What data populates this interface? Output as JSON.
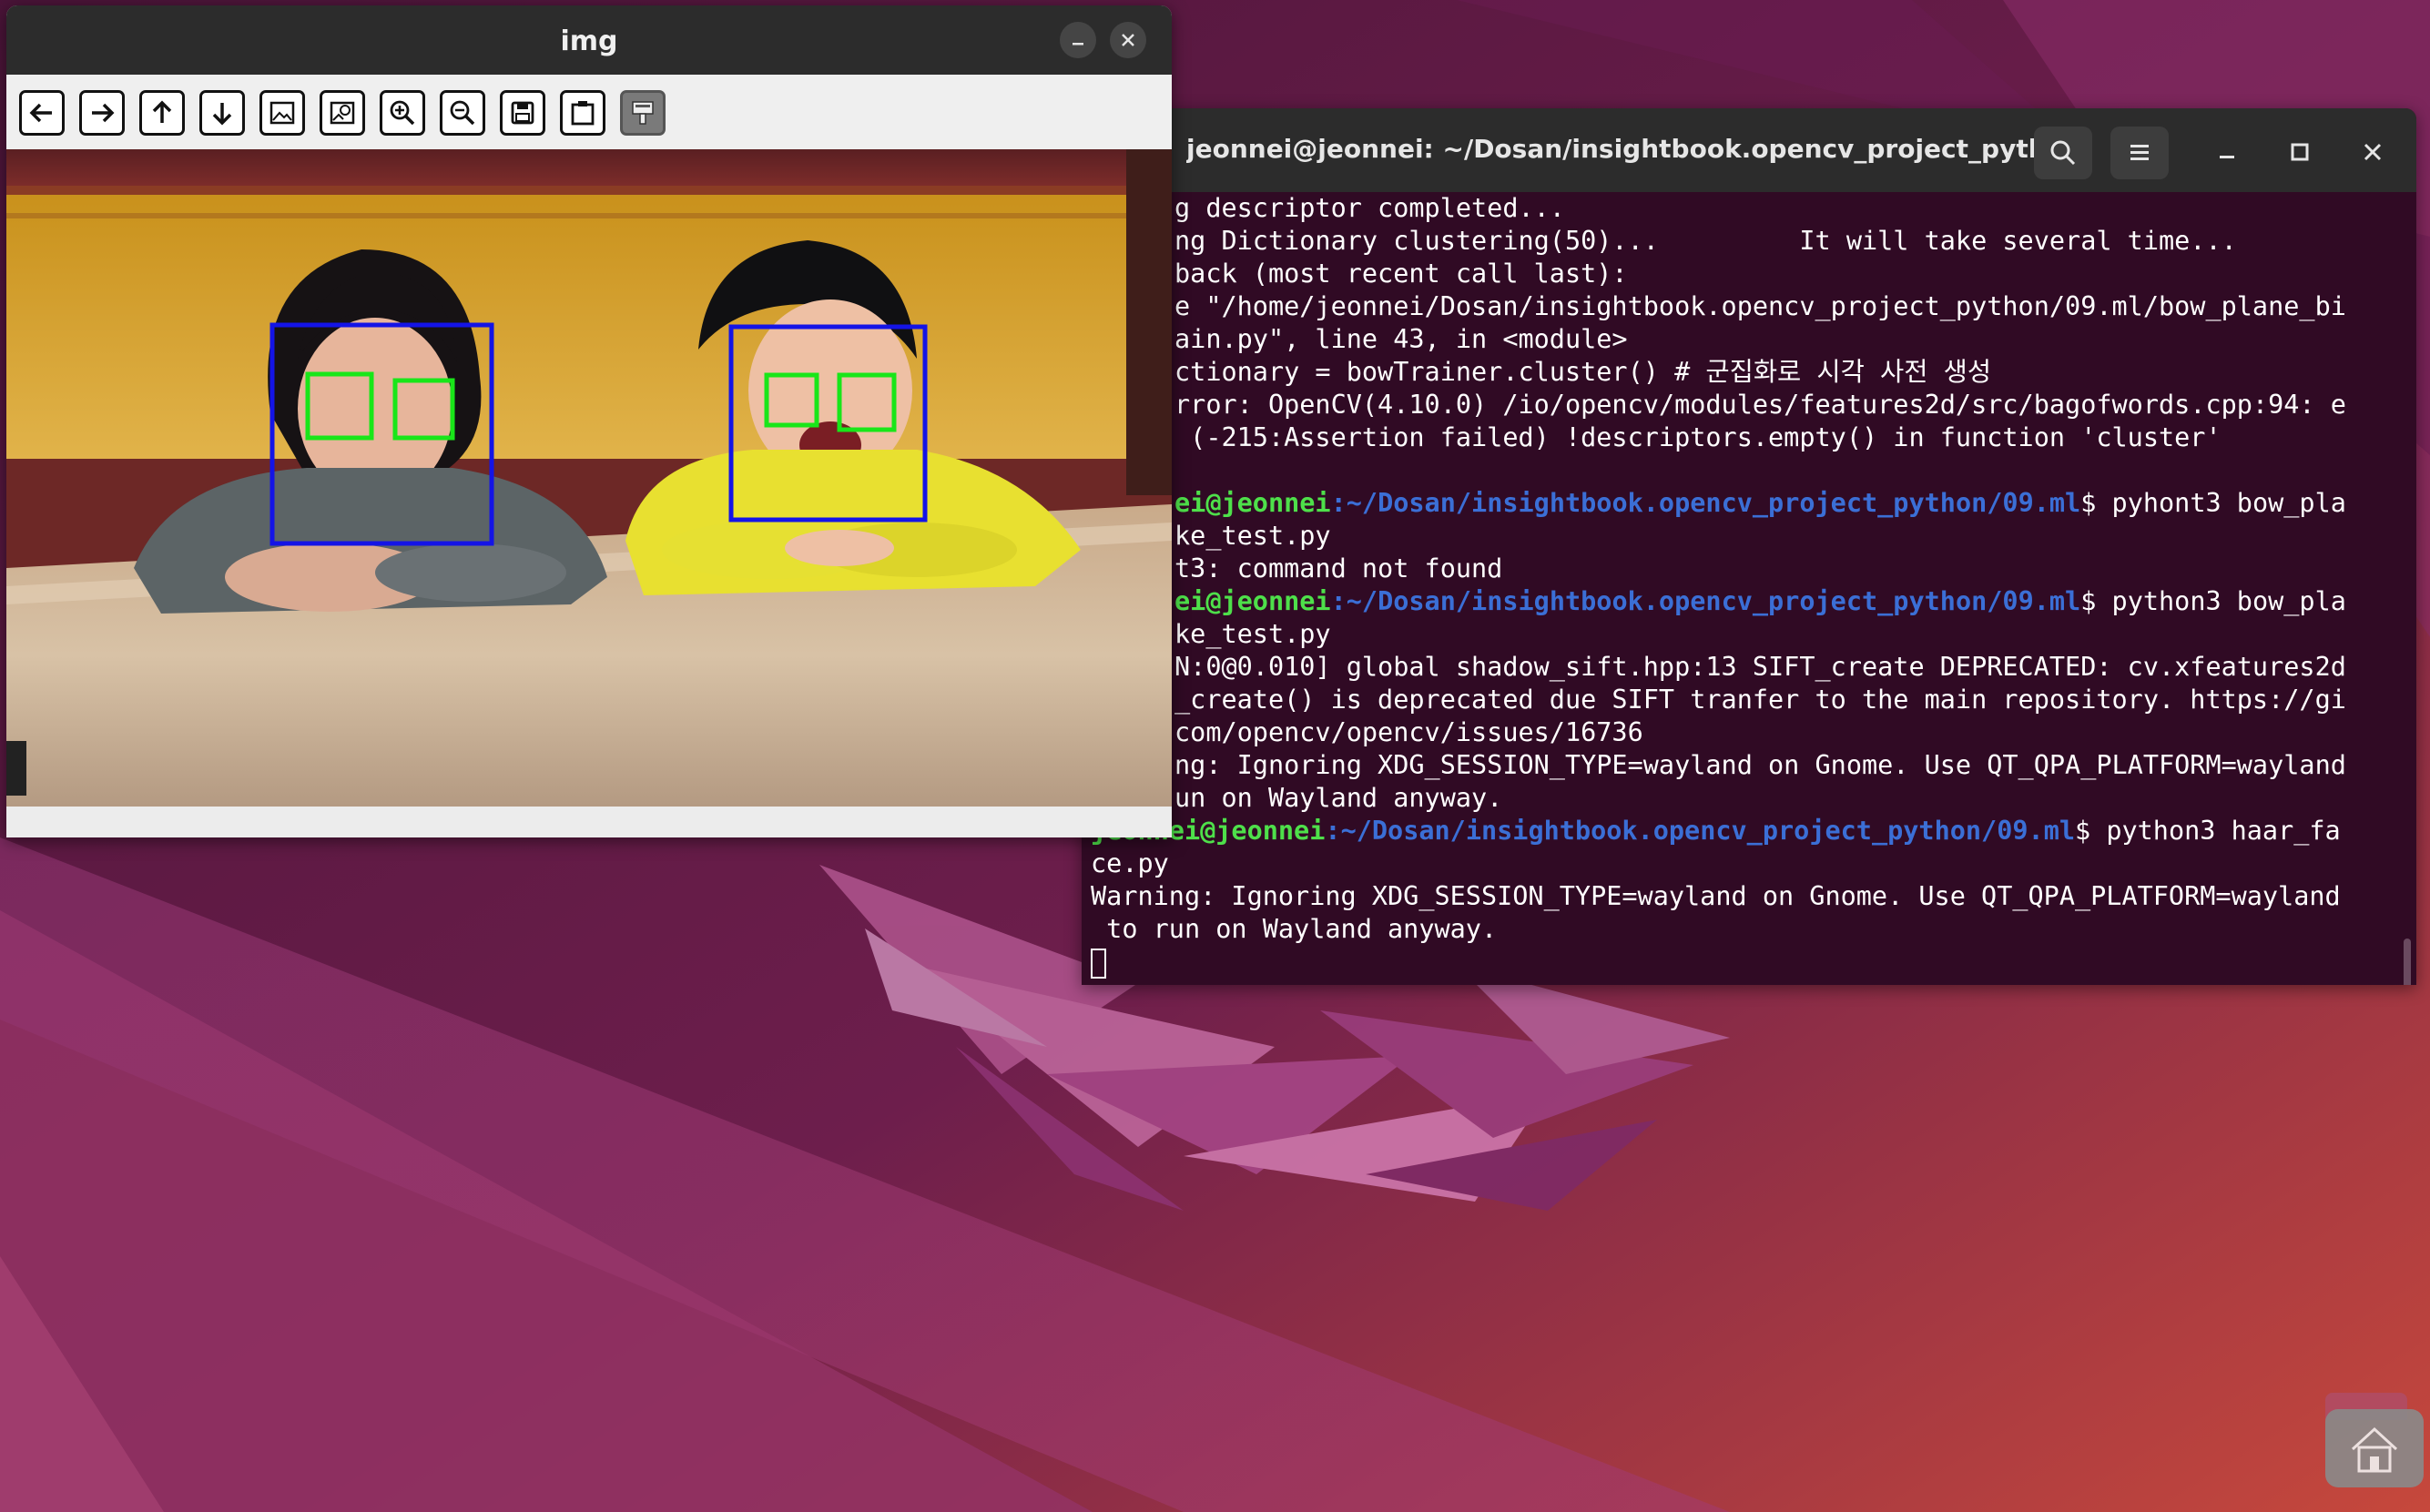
{
  "img_window": {
    "title": "img"
  },
  "terminal": {
    "title": "jeonnei@jeonnei: ~/Dosan/insightbook.opencv_project_pyth...",
    "lines": [
      {
        "text": "g descriptor completed..."
      },
      {
        "text": "ng Dictionary clustering(50)...         It will take several time..."
      },
      {
        "text": "back (most recent call last):"
      },
      {
        "text": "e \"/home/jeonnei/Dosan/insightbook.opencv_project_python/09.ml/bow_plane_bi"
      },
      {
        "text": "ain.py\", line 43, in <module>"
      },
      {
        "text": "ctionary = bowTrainer.cluster() # 군집화로 시각 사전 생성"
      },
      {
        "text": "rror: OpenCV(4.10.0) /io/opencv/modules/features2d/src/bagofwords.cpp:94: e"
      },
      {
        "text": " (-215:Assertion failed) !descriptors.empty() in function 'cluster'"
      },
      {
        "text": ""
      },
      {
        "user": "ei@jeonnei",
        "path": "~/Dosan/insightbook.opencv_project_python/09.ml",
        "cmd": "$ pyhont3 bow_pla"
      },
      {
        "text": "ke_test.py"
      },
      {
        "text": "t3: command not found"
      },
      {
        "user": "ei@jeonnei",
        "path": "~/Dosan/insightbook.opencv_project_python/09.ml",
        "cmd": "$ python3 bow_pla"
      },
      {
        "text": "ke_test.py"
      },
      {
        "text": "N:0@0.010] global shadow_sift.hpp:13 SIFT_create DEPRECATED: cv.xfeatures2d"
      },
      {
        "text": "_create() is deprecated due SIFT tranfer to the main repository. https://gi"
      },
      {
        "text": "com/opencv/opencv/issues/16736"
      },
      {
        "text": "ng: Ignoring XDG_SESSION_TYPE=wayland on Gnome. Use QT_QPA_PLATFORM=wayland"
      },
      {
        "text": "un on Wayland anyway."
      },
      {
        "user": "jeonnei@jeonnei",
        "path": "~/Dosan/insightbook.opencv_project_python/09.ml",
        "cmd": "$ python3 haar_fa",
        "full": true
      },
      {
        "text": "ce.py",
        "full": true
      },
      {
        "text": "Warning: Ignoring XDG_SESSION_TYPE=wayland on Gnome. Use QT_QPA_PLATFORM=wayland",
        "full": true
      },
      {
        "text": " to run on Wayland anyway.",
        "full": true
      },
      {
        "cursor": true,
        "full": true
      }
    ]
  },
  "colors": {
    "terminal_bg": "#300a24",
    "prompt_user": "#4ee04a",
    "prompt_path": "#3b6fd6",
    "face_box": "#1414e6",
    "eye_box": "#19e619"
  },
  "icons": {
    "toolbar": [
      "arrow-left-icon",
      "arrow-right-icon",
      "arrow-up-icon",
      "arrow-down-icon",
      "image-icon",
      "image-search-icon",
      "zoom-in-icon",
      "zoom-out-icon",
      "save-icon",
      "clipboard-icon",
      "paint-icon"
    ],
    "terminal_header": [
      "search-icon",
      "menu-icon",
      "minimize-icon",
      "maximize-icon",
      "close-icon"
    ],
    "img_header": [
      "minimize-icon",
      "close-icon"
    ],
    "dock": [
      "home-icon"
    ]
  }
}
